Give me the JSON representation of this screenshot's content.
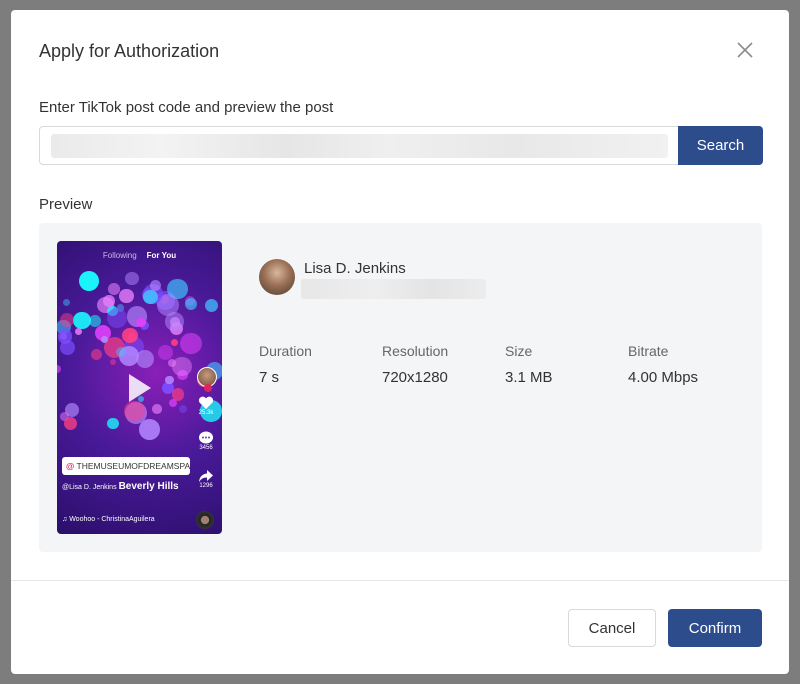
{
  "dialog": {
    "title": "Apply for Authorization",
    "close_icon": "close-icon"
  },
  "search": {
    "label": "Enter TikTok post code and preview the post",
    "value": "",
    "button_label": "Search"
  },
  "preview": {
    "label": "Preview",
    "thumbnail": {
      "tab_following": "Following",
      "tab_for_you": "For You",
      "tag": "THEMUSEUMOFDREAMSPACE",
      "caption_user": "@Lisa D. Jenkins",
      "caption_place": "Beverly Hills",
      "music": "♫ Woohoo - ChristinaAguilera",
      "likes": "25.3k",
      "comments": "3456",
      "shares": "1296",
      "play_icon": "play-icon"
    },
    "user": {
      "name": "Lisa D. Jenkins"
    },
    "stats": [
      {
        "label": "Duration",
        "value": "7 s"
      },
      {
        "label": "Resolution",
        "value": "720x1280"
      },
      {
        "label": "Size",
        "value": "3.1 MB"
      },
      {
        "label": "Bitrate",
        "value": "4.00 Mbps"
      }
    ]
  },
  "footer": {
    "cancel_label": "Cancel",
    "confirm_label": "Confirm"
  },
  "colors": {
    "primary": "#2c4c8c",
    "overlay": "#7d7d7d",
    "card_bg": "#f4f5f7"
  }
}
